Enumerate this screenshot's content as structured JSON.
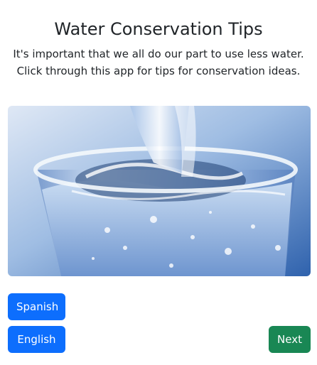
{
  "header": {
    "title": "Water Conservation Tips",
    "intro": "It's important that we all do our part to use less water. Click through this app for tips for conservation ideas."
  },
  "hero_image": {
    "subject": "water pouring into a glass",
    "colors": {
      "background_light": "#e3ebf6",
      "background_dark": "#3c6fb5",
      "water": "#9cc0e6",
      "glass_rim": "#f4f8fc"
    }
  },
  "language_buttons": {
    "spanish_label": "Spanish",
    "english_label": "English"
  },
  "navigation": {
    "next_label": "Next"
  },
  "colors": {
    "primary": "#0d6efd",
    "success": "#198754",
    "text": "#212529"
  }
}
